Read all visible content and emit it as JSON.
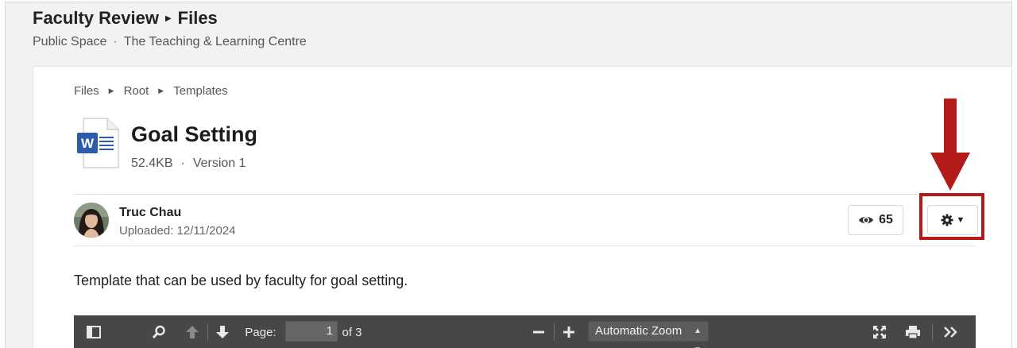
{
  "header": {
    "title": "Faculty Review",
    "section": "Files",
    "space_type": "Public Space",
    "space_name": "The Teaching & Learning Centre"
  },
  "breadcrumb": [
    "Files",
    "Root",
    "Templates"
  ],
  "file": {
    "icon": "word-document-icon",
    "icon_letter": "W",
    "title": "Goal Setting",
    "size": "52.4KB",
    "version": "Version 1",
    "description": "Template that can be used by faculty for goal setting."
  },
  "uploader": {
    "name": "Truc Chau",
    "uploaded": "Uploaded: 12/11/2024"
  },
  "stats": {
    "views": "65",
    "views_icon": "eye-icon"
  },
  "actions": {
    "settings_icon": "gear-icon",
    "dropdown_icon": "caret-down-icon"
  },
  "annotation": {
    "color": "#b31b1b"
  },
  "pdf_viewer": {
    "page_label": "Page:",
    "page_number": "1",
    "page_total": "of 3",
    "zoom": "Automatic Zoom"
  },
  "colors": {
    "accent_word": "#2b5cab",
    "toolbar_bg": "#474747"
  }
}
